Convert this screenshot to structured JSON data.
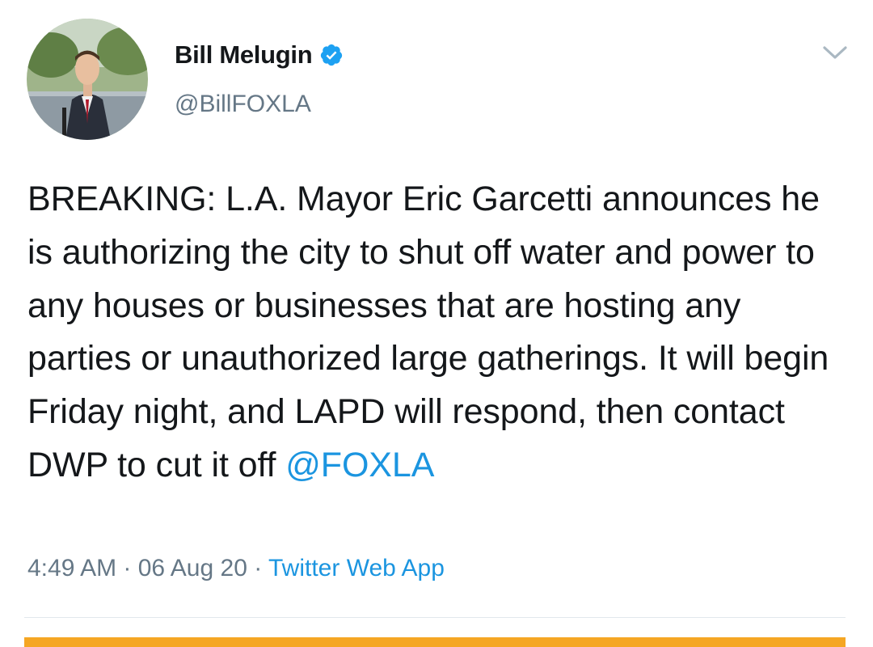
{
  "author": {
    "display_name": "Bill Melugin",
    "handle": "@BillFOXLA",
    "verified": true,
    "avatar_icon": "profile-photo"
  },
  "tweet": {
    "text": "BREAKING: L.A. Mayor Eric Garcetti announces he is authorizing the city to shut off water and power to any houses or businesses that are hosting any parties or unauthorized large gatherings. It will begin Friday night, and LAPD will respond, then contact DWP to cut it off ",
    "mention": "@FOXLA"
  },
  "meta": {
    "time": "4:49 AM",
    "separator": " · ",
    "date": "06 Aug 20",
    "source": "Twitter Web App"
  },
  "colors": {
    "accent": "#1b95e0",
    "verified": "#1da1f2",
    "muted": "#657786",
    "bottom_bar": "#f5a623"
  },
  "icons": {
    "verified": "verified-badge-icon",
    "menu": "chevron-down-icon"
  }
}
